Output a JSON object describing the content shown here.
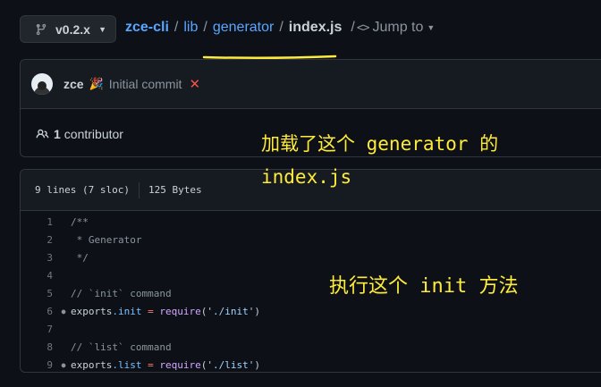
{
  "branch": {
    "label": "v0.2.x",
    "icon": "git-branch-icon"
  },
  "breadcrumb": {
    "repo": "zce-cli",
    "sep": "/",
    "lib": "lib",
    "generator": "generator",
    "file": "index.js",
    "jump_label": "Jump to"
  },
  "commit": {
    "author": "zce",
    "emoji": "🎉",
    "message": "Initial commit",
    "status": "✕"
  },
  "contributors": {
    "count": "1",
    "label": "contributor"
  },
  "file_info": {
    "lines": "9 lines (7 sloc)",
    "size": "125 Bytes"
  },
  "code": {
    "lines": [
      {
        "n": "1",
        "t": "/**"
      },
      {
        "n": "2",
        "t": " * Generator"
      },
      {
        "n": "3",
        "t": " */"
      },
      {
        "n": "4",
        "t": ""
      },
      {
        "n": "5",
        "t": "// `init` command"
      },
      {
        "n": "6",
        "a": "exports",
        "b": ".init",
        "c": " = ",
        "d": "require",
        "e": "(",
        "f": "'./init'",
        "g": ")"
      },
      {
        "n": "7",
        "t": ""
      },
      {
        "n": "8",
        "t": "// `list` command"
      },
      {
        "n": "9",
        "a": "exports",
        "b": ".list",
        "c": " = ",
        "d": "require",
        "e": "(",
        "f": "'./list'",
        "g": ")"
      }
    ]
  },
  "annotations": {
    "line1": "加载了这个 generator 的",
    "line2": "index.js",
    "line3": "执行这个 init 方法"
  },
  "colors": {
    "annotation": "#ffeb3b",
    "link": "#58a6ff",
    "background": "#0d1117"
  }
}
